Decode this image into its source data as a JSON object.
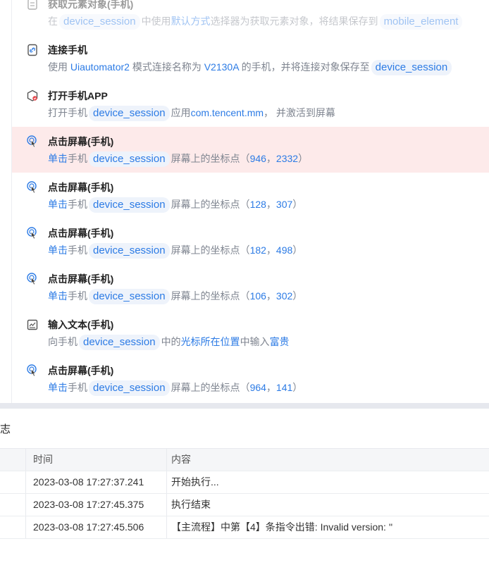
{
  "steps": [
    {
      "title": "获取元素对象(手机)",
      "icon": "element-icon",
      "parts": [
        {
          "t": "在"
        },
        {
          "tag": "device_session"
        },
        {
          "t": "中使用"
        },
        {
          "h": "默认方式"
        },
        {
          "t": "选择器为获取元素对象，将结果保存到"
        },
        {
          "tag": "mobile_element"
        }
      ]
    },
    {
      "title": "连接手机",
      "icon": "connect-phone-icon",
      "parts": [
        {
          "t": "使用 "
        },
        {
          "h": "Uiautomator2"
        },
        {
          "t": " 模式连接名称为 "
        },
        {
          "h": "V2130A"
        },
        {
          "t": " 的手机，并将连接对象保存至"
        },
        {
          "tag": "device_session"
        }
      ]
    },
    {
      "title": "打开手机APP",
      "icon": "open-app-icon",
      "parts": [
        {
          "t": "打开手机"
        },
        {
          "tag": "device_session"
        },
        {
          "t": "应用"
        },
        {
          "h": "com.tencent.mm"
        },
        {
          "t": "， 并激活到屏幕"
        }
      ]
    },
    {
      "title": "点击屏幕(手机)",
      "icon": "tap-icon",
      "highlight": true,
      "parts": [
        {
          "h": "单击"
        },
        {
          "t": "手机"
        },
        {
          "tag": "device_session"
        },
        {
          "t": "屏幕上的坐标点（"
        },
        {
          "h": "946"
        },
        {
          "t": "，"
        },
        {
          "h": "2332"
        },
        {
          "t": "）"
        }
      ]
    },
    {
      "title": "点击屏幕(手机)",
      "icon": "tap-icon",
      "parts": [
        {
          "h": "单击"
        },
        {
          "t": "手机"
        },
        {
          "tag": "device_session"
        },
        {
          "t": "屏幕上的坐标点（"
        },
        {
          "h": "128"
        },
        {
          "t": "，"
        },
        {
          "h": "307"
        },
        {
          "t": "）"
        }
      ]
    },
    {
      "title": "点击屏幕(手机)",
      "icon": "tap-icon",
      "parts": [
        {
          "h": "单击"
        },
        {
          "t": "手机"
        },
        {
          "tag": "device_session"
        },
        {
          "t": "屏幕上的坐标点（"
        },
        {
          "h": "182"
        },
        {
          "t": "，"
        },
        {
          "h": "498"
        },
        {
          "t": "）"
        }
      ]
    },
    {
      "title": "点击屏幕(手机)",
      "icon": "tap-icon",
      "parts": [
        {
          "h": "单击"
        },
        {
          "t": "手机"
        },
        {
          "tag": "device_session"
        },
        {
          "t": "屏幕上的坐标点（"
        },
        {
          "h": "106"
        },
        {
          "t": "，"
        },
        {
          "h": "302"
        },
        {
          "t": "）"
        }
      ]
    },
    {
      "title": "输入文本(手机)",
      "icon": "input-text-icon",
      "parts": [
        {
          "t": "向手机"
        },
        {
          "tag": "device_session"
        },
        {
          "t": "中的"
        },
        {
          "h": "光标所在位置"
        },
        {
          "t": "中输入"
        },
        {
          "h": "富贵"
        }
      ]
    },
    {
      "title": "点击屏幕(手机)",
      "icon": "tap-icon",
      "parts": [
        {
          "h": "单击"
        },
        {
          "t": "手机"
        },
        {
          "tag": "device_session"
        },
        {
          "t": "屏幕上的坐标点（"
        },
        {
          "h": "964"
        },
        {
          "t": "，"
        },
        {
          "h": "141"
        },
        {
          "t": "）"
        }
      ]
    }
  ],
  "log": {
    "title": "志",
    "headers": {
      "time": "时间",
      "content": "内容"
    },
    "rows": [
      {
        "time": "2023-03-08 17:27:37.241",
        "content": "开始执行..."
      },
      {
        "time": "2023-03-08 17:27:45.375",
        "content": "执行结束"
      },
      {
        "time": "2023-03-08 17:27:45.506",
        "content": "【主流程】中第【4】条指令出错:  Invalid version: ''"
      }
    ]
  },
  "colors": {
    "accent": "#2c7be5",
    "highlight_bg": "#fdeaea",
    "tap_icon": "#2c7be5",
    "error_dot": "#e5484d"
  }
}
